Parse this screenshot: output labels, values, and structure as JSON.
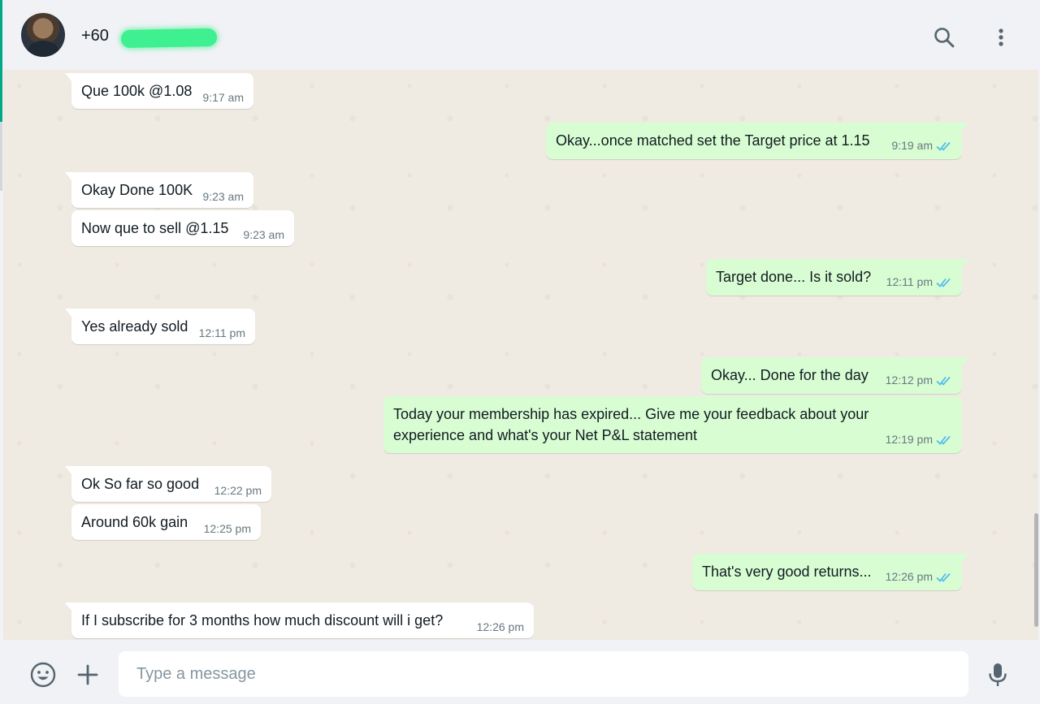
{
  "header": {
    "contact_name": "+60"
  },
  "messages": [
    {
      "dir": "in",
      "text": "Que 100k @1.08",
      "time": "9:17 am"
    },
    {
      "dir": "out",
      "text": "Okay...once matched set the Target price at 1.15",
      "time": "9:19 am"
    },
    {
      "dir": "in",
      "text": "Okay Done 100K",
      "time": "9:23 am"
    },
    {
      "dir": "in",
      "text": "Now que to sell @1.15",
      "time": "9:23 am"
    },
    {
      "dir": "out",
      "text": "Target done... Is it sold?",
      "time": "12:11 pm"
    },
    {
      "dir": "in",
      "text": "Yes already sold",
      "time": "12:11 pm"
    },
    {
      "dir": "out",
      "text": "Okay... Done for the day",
      "time": "12:12 pm"
    },
    {
      "dir": "out",
      "text": "Today your membership has expired... Give me your feedback about your experience and what's your Net P&L statement",
      "time": "12:19 pm"
    },
    {
      "dir": "in",
      "text": "Ok So far so good",
      "time": "12:22 pm"
    },
    {
      "dir": "in",
      "text": "Around 60k gain",
      "time": "12:25 pm"
    },
    {
      "dir": "out",
      "text": "That's very good returns...",
      "time": "12:26 pm"
    },
    {
      "dir": "in",
      "text": "If I subscribe for 3 months how much discount will i get?",
      "time": "12:26 pm"
    }
  ],
  "composer": {
    "placeholder": "Type a message"
  },
  "icons": {
    "header": [
      "search-icon",
      "menu-icon"
    ],
    "footer": [
      "emoji-icon",
      "plus-icon",
      "mic-icon"
    ],
    "read_receipt": "double-check-icon"
  },
  "colors": {
    "accent": "#00a884",
    "incoming_bubble": "#ffffff",
    "outgoing_bubble": "#d9fdd3",
    "chat_background": "#efeae2",
    "read_ticks": "#53bdeb",
    "redaction": "#3ef08f"
  }
}
